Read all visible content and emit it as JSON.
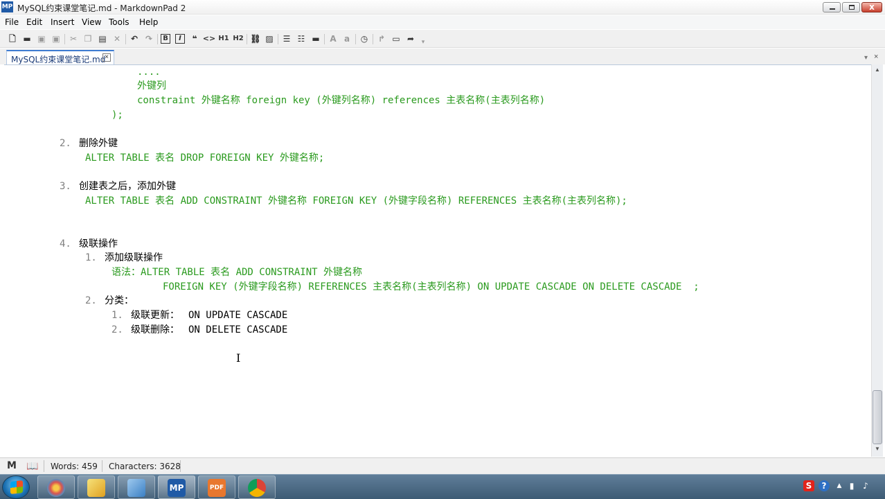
{
  "window": {
    "title": "MySQL约束课堂笔记.md - MarkdownPad 2",
    "app_icon_label": "MP",
    "close_glyph": "x"
  },
  "menu": {
    "items": [
      "File",
      "Edit",
      "Insert",
      "View",
      "Tools",
      "Help"
    ]
  },
  "toolbar": {
    "bold": "B",
    "italic": "I",
    "quote": "❝",
    "code": "<>",
    "h1": "H1",
    "h2": "H2",
    "font_larger": "A",
    "font_smaller": "a"
  },
  "tabs": {
    "active_label": "MySQL约束课堂笔记.md",
    "close_glyph": "×",
    "dropdown_glyph": "▾",
    "pane_close_glyph": "×"
  },
  "editor": {
    "lines": [
      {
        "kind": "code",
        "text": "...."
      },
      {
        "kind": "code",
        "text": "外键列"
      },
      {
        "kind": "code",
        "text": "constraint 外键名称 foreign key (外键列名称) references 主表名称(主表列名称)"
      },
      {
        "kind": "code",
        "text": ");"
      },
      {
        "kind": "marker",
        "text": "2."
      },
      {
        "kind": "txt",
        "text": "删除外键"
      },
      {
        "kind": "code",
        "text": "ALTER TABLE 表名 DROP FOREIGN KEY 外键名称;"
      },
      {
        "kind": "marker",
        "text": "3."
      },
      {
        "kind": "txt",
        "text": "创建表之后，添加外键"
      },
      {
        "kind": "code",
        "text": "ALTER TABLE 表名 ADD CONSTRAINT 外键名称 FOREIGN KEY (外键字段名称) REFERENCES 主表名称(主表列名称);"
      },
      {
        "kind": "marker",
        "text": "4."
      },
      {
        "kind": "txt",
        "text": "级联操作"
      },
      {
        "kind": "marker",
        "text": "1."
      },
      {
        "kind": "txt",
        "text": "添加级联操作"
      },
      {
        "kind": "code",
        "text": "语法：ALTER TABLE 表名 ADD CONSTRAINT 外键名称"
      },
      {
        "kind": "code",
        "text": "FOREIGN KEY (外键字段名称) REFERENCES 主表名称(主表列名称) ON UPDATE CASCADE ON DELETE CASCADE  ;"
      },
      {
        "kind": "marker",
        "text": "2."
      },
      {
        "kind": "txt",
        "text": "分类："
      },
      {
        "kind": "marker",
        "text": "1."
      },
      {
        "kind": "txt",
        "text": "级联更新："
      },
      {
        "kind": "plain",
        "text": "ON UPDATE CASCADE"
      },
      {
        "kind": "marker",
        "text": "2."
      },
      {
        "kind": "txt",
        "text": "级联删除："
      },
      {
        "kind": "plain",
        "text": "ON DELETE CASCADE"
      }
    ],
    "caret_glyph": "I"
  },
  "scrollbar": {
    "up_glyph": "▲",
    "down_glyph": "▼"
  },
  "status": {
    "words": "Words: 459",
    "characters": "Characters: 3628",
    "md_glyph": "M"
  },
  "taskbar": {
    "apps": [
      {
        "name": "colorful-app",
        "glyph": "",
        "color": "#d9534f"
      },
      {
        "name": "pen-app",
        "glyph": "",
        "color": "#e0a020"
      },
      {
        "name": "dolphin-app",
        "glyph": "",
        "color": "#3a7fc4"
      },
      {
        "name": "markdownpad",
        "glyph": "MP",
        "color": "#1f5aa6"
      },
      {
        "name": "pdf-app",
        "glyph": "PDF",
        "color": "#e8772e"
      },
      {
        "name": "chrome",
        "glyph": "",
        "color": "#db4437"
      }
    ],
    "tray": {
      "ime_glyph": "S",
      "help_glyph": "?",
      "arrow_glyph": "▲",
      "volume_glyph": "♪"
    }
  }
}
